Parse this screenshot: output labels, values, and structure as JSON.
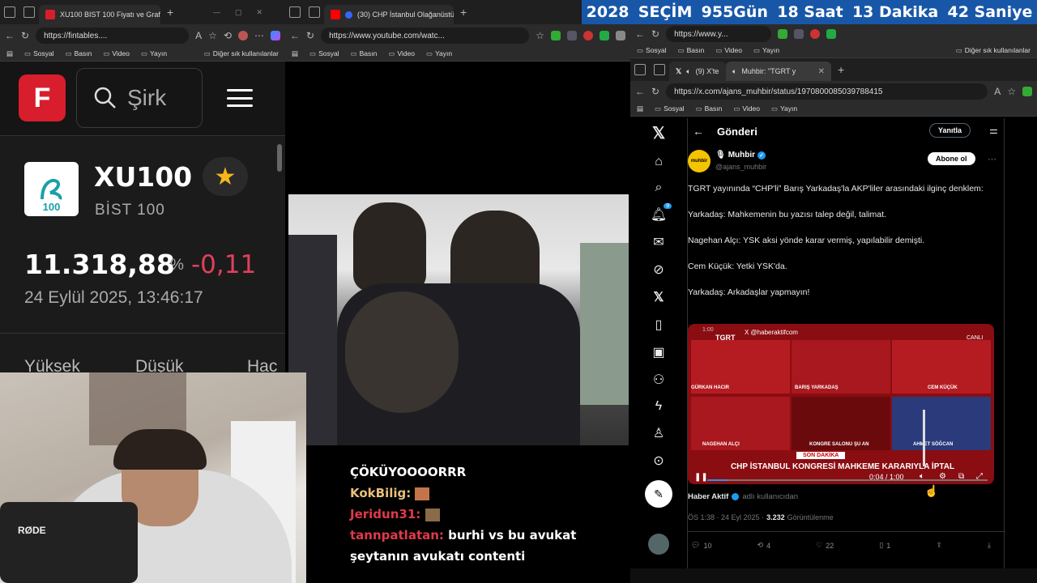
{
  "countdown": {
    "year": "2028",
    "label": "SEÇİM",
    "days": "955Gün",
    "hours": "18 Saat",
    "minutes": "13 Dakika",
    "seconds": "42 Saniye"
  },
  "left_browser": {
    "tab_title": "XU100 BIST 100 Fiyatı ve Grafi",
    "url": "https://fintables....",
    "bookmarks": [
      "Sosyal",
      "Basın",
      "Video",
      "Yayın"
    ],
    "other_bookmarks": "Diğer sık kullanılanlar",
    "logo_letter": "F",
    "search_placeholder": "Şirk",
    "ticker": "XU100",
    "ticker_name": "BİST 100",
    "logo_text": "100",
    "price": "11.318,88",
    "pct_symbol": "%",
    "change": "-0,11",
    "timestamp": "24 Eylül 2025, 13:46:17",
    "col_high": "Yüksek",
    "col_low": "Düşük",
    "col_vol": "Hac"
  },
  "mid_browser": {
    "tab_title": "(30) CHP İstanbul Olağanüstü",
    "url": "https://www.youtube.com/watc...",
    "bookmarks": [
      "Sosyal",
      "Basın",
      "Video",
      "Yayın"
    ]
  },
  "chat": [
    {
      "user": "",
      "msg": "ÇÖKÜYOOOORRR",
      "color": "#ffffff"
    },
    {
      "user": "KokBilig:",
      "msg": "",
      "color": "#e8c07a"
    },
    {
      "user": "Jeridun31:",
      "msg": "",
      "color": "#e03a4a"
    },
    {
      "user": "tannpatlatan:",
      "msg": "burhi vs bu avukat",
      "color": "#e03a4a"
    },
    {
      "user": "",
      "msg": "şeytanın avukatı contenti",
      "color": "#ffffff"
    }
  ],
  "webcam": {
    "mic_label": "RØDE"
  },
  "right_top_browser": {
    "url": "https://www.y...",
    "bookmarks": [
      "Sosyal",
      "Basın",
      "Video",
      "Yayın"
    ],
    "other_bookmarks": "Diğer sık kullanılanlar"
  },
  "x_browser": {
    "tab_title": "(9) X'te",
    "tab2_title": "Muhbir: \"TGRT y",
    "url": "https://x.com/ajans_muhbir/status/1970800085039788415",
    "bookmarks": [
      "Sosyal",
      "Basın",
      "Video",
      "Yayın"
    ],
    "header_title": "Gönderi",
    "reply_button": "Yanıtla",
    "notification_count": "9",
    "author_name": "Muhbir",
    "author_handle": "@ajans_muhbir",
    "avatar_text": "muhbir",
    "subscribe_button": "Abone ol",
    "tweet_lines": [
      "TGRT yayınında “CHP'li” Barış Yarkadaş'la AKP'liler arasındaki ilginç denklem:",
      "Yarkadaş: Mahkemenin bu yazısı talep değil, talimat.",
      "Nagehan Alçı: YSK aksi yönde karar vermiş, yapılabilir demişti.",
      "Cem Küçük: Yetki YSK'da.",
      "Yarkadaş: Arkadaşlar yapmayın!"
    ],
    "video_watermark": "X @haberaktifcom",
    "video_brand": "TGRT",
    "video_live": "CANLI",
    "video_banner": "SON DAKİKA",
    "video_ticker": "CHP İSTANBUL KONGRESİ MAHKEME KARARIYLA İPTAL",
    "video_time": "0:04 / 1:00",
    "video_overlay_time": "1:00",
    "video_names": [
      "GÜRKAN HACIR",
      "BARIŞ YARKADAŞ",
      "CEM KÜÇÜK",
      "NAGEHAN ALÇI",
      "KONGRE SALONU ŞU AN",
      "AHMET SÖĞCAN"
    ],
    "source_name": "Haber Aktif",
    "source_suffix": "adlı kullanıcıdan",
    "meta_time": "ÖS 1:38 · 24 Eyl 2025 ·",
    "views": "3.232",
    "views_label": "Görüntülenme",
    "replies": "10",
    "retweets": "4",
    "likes": "22",
    "bookmarks_count": "1"
  },
  "colors": {
    "negative": "#e0405a",
    "star": "#f5b81a",
    "x_blue": "#1d9bf0",
    "fintables_red": "#d81e2c",
    "countdown_bg": "#1857a8"
  }
}
